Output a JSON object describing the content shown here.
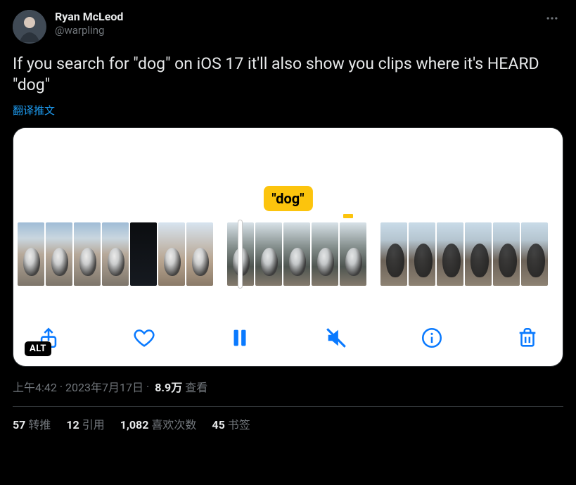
{
  "author": {
    "display_name": "Ryan McLeod",
    "handle": "@warpling"
  },
  "tweet_text": "If you search for \"dog\" on iOS 17 it'll also show you clips where it's HEARD \"dog\"",
  "translate_label": "翻译推文",
  "media": {
    "bubble_label": "\"dog\"",
    "alt_badge": "ALT"
  },
  "meta": {
    "time": "上午4:42",
    "date": "2023年7月17日",
    "views_number": "8.9万",
    "views_label": "查看",
    "separator": "·"
  },
  "stats": {
    "retweets_n": "57",
    "retweets_label": "转推",
    "quotes_n": "12",
    "quotes_label": "引用",
    "likes_n": "1,082",
    "likes_label": "喜欢次数",
    "bookmarks_n": "45",
    "bookmarks_label": "书签"
  }
}
